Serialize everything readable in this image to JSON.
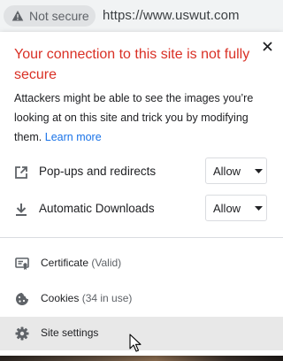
{
  "omnibox": {
    "security_chip_label": "Not secure",
    "url": "https://www.uswut.com",
    "warning_icon": "warning-triangle-icon"
  },
  "page_info": {
    "headline": "Your connection to this site is not fully secure",
    "description": "Attackers might be able to see the images you’re looking at on this site and trick you by modifying them.",
    "learn_more": "Learn more",
    "close_icon": "close-icon"
  },
  "permissions": [
    {
      "label": "Pop-ups and redirects",
      "value": "Allow",
      "icon": "open-in-new-icon"
    },
    {
      "label": "Automatic Downloads",
      "value": "Allow",
      "icon": "download-icon"
    }
  ],
  "info_rows": [
    {
      "label": "Certificate",
      "sub": "(Valid)",
      "icon": "certificate-icon"
    },
    {
      "label": "Cookies",
      "sub": "(34 in use)",
      "icon": "cookie-icon"
    },
    {
      "label": "Site settings",
      "sub": "",
      "icon": "gear-icon"
    }
  ],
  "colors": {
    "warning_text": "#d93025",
    "link": "#1a73e8",
    "hover_row": "#e8e8e8"
  }
}
